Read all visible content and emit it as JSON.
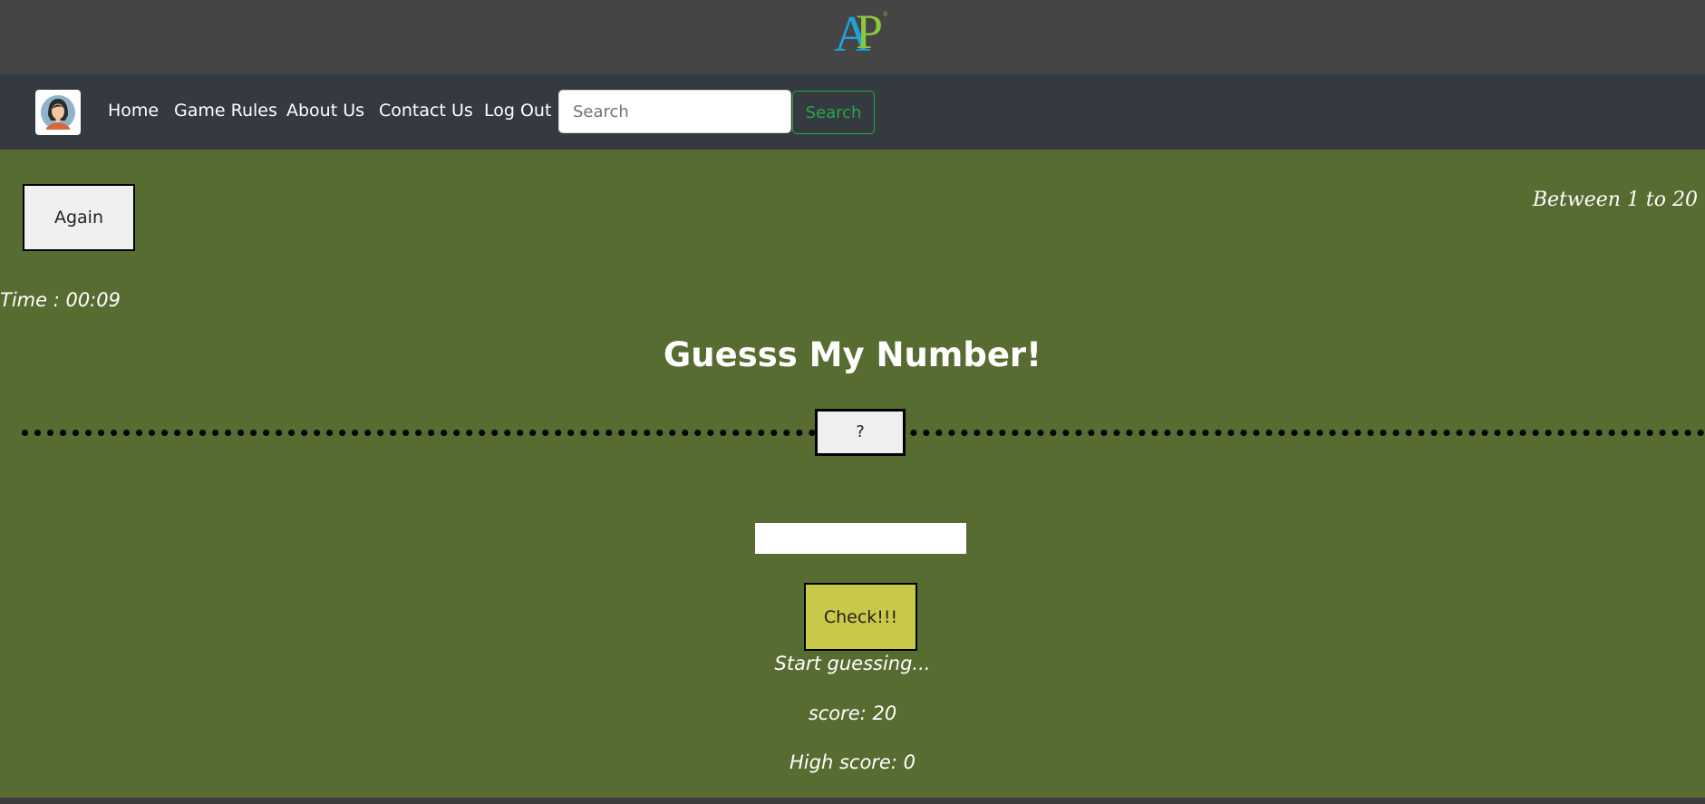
{
  "header": {
    "logo_letters": [
      "A",
      "P"
    ],
    "logo_mark": "®",
    "colors": {
      "topbar": "#454545",
      "logo_a": "#1fa2d9",
      "logo_p": "#8dc63f"
    }
  },
  "navbar": {
    "avatar_icon": "user-avatar-icon",
    "links": [
      "Home",
      "Game Rules",
      "About Us",
      "Contact Us",
      "Log Out"
    ],
    "search_placeholder": "Search",
    "search_button": "Search",
    "colors": {
      "background": "#343a40",
      "search_accent": "#28a745"
    }
  },
  "game": {
    "again_label": "Again",
    "range_text": "Between 1 to 20",
    "timer_text": "Time : 00:09",
    "title": "Guesss My Number!",
    "secret_display": "?",
    "guess_value": "",
    "check_label": "Check!!!",
    "message": "Start guessing...",
    "score_text": "score: 20",
    "highscore_text": "High score: 0",
    "colors": {
      "background": "#566c30",
      "check_button": "#c8c84a"
    }
  }
}
